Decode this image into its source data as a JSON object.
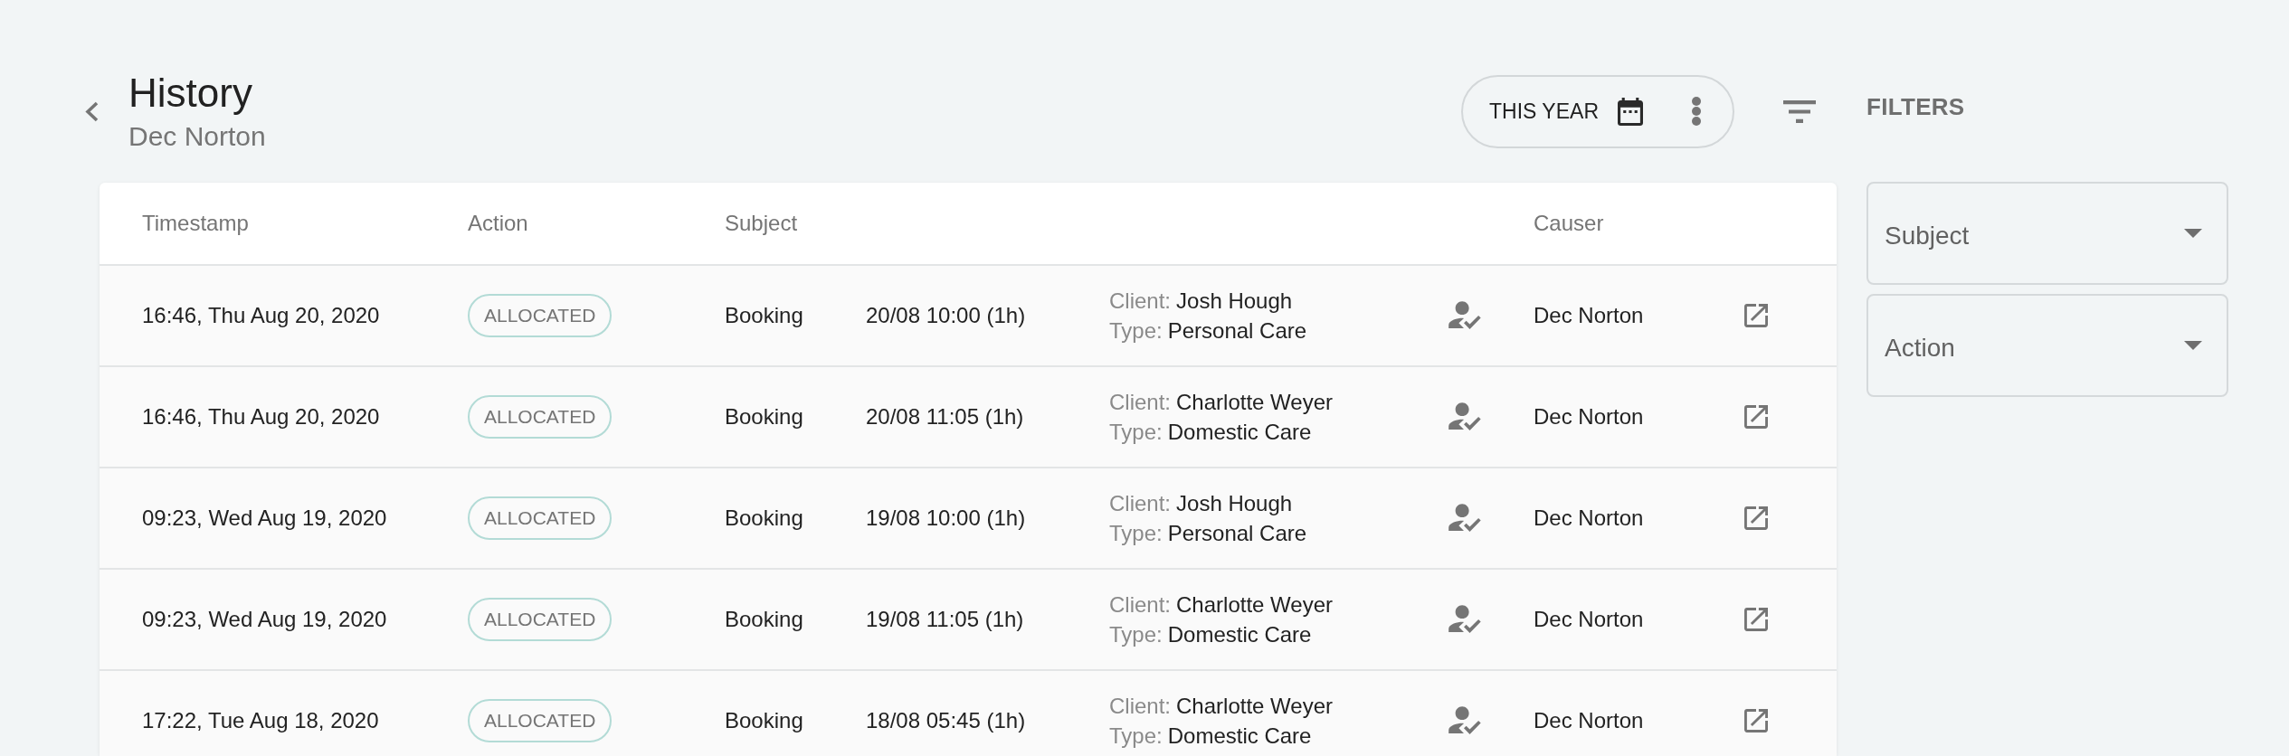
{
  "header": {
    "title": "History",
    "subtitle": "Dec Norton"
  },
  "period_selector": {
    "label": "THIS YEAR"
  },
  "filters": {
    "heading": "FILTERS",
    "dropdowns": [
      {
        "label": "Subject"
      },
      {
        "label": "Action"
      }
    ]
  },
  "table": {
    "columns": [
      {
        "label": "Timestamp"
      },
      {
        "label": "Action"
      },
      {
        "label": "Subject"
      },
      {
        "label": "Causer"
      }
    ],
    "rows": [
      {
        "timestamp": "16:46, Thu Aug 20, 2020",
        "action": "ALLOCATED",
        "subject": "Booking",
        "slot": "20/08 10:00 (1h)",
        "details": [
          {
            "label": "Client:",
            "value": "Josh Hough"
          },
          {
            "label": "Type:",
            "value": "Personal Care"
          }
        ],
        "causer": "Dec Norton"
      },
      {
        "timestamp": "16:46, Thu Aug 20, 2020",
        "action": "ALLOCATED",
        "subject": "Booking",
        "slot": "20/08 11:05 (1h)",
        "details": [
          {
            "label": "Client:",
            "value": "Charlotte Weyer"
          },
          {
            "label": "Type:",
            "value": "Domestic Care"
          }
        ],
        "causer": "Dec Norton"
      },
      {
        "timestamp": "09:23, Wed Aug 19, 2020",
        "action": "ALLOCATED",
        "subject": "Booking",
        "slot": "19/08 10:00 (1h)",
        "details": [
          {
            "label": "Client:",
            "value": "Josh Hough"
          },
          {
            "label": "Type:",
            "value": "Personal Care"
          }
        ],
        "causer": "Dec Norton"
      },
      {
        "timestamp": "09:23, Wed Aug 19, 2020",
        "action": "ALLOCATED",
        "subject": "Booking",
        "slot": "19/08 11:05 (1h)",
        "details": [
          {
            "label": "Client:",
            "value": "Charlotte Weyer"
          },
          {
            "label": "Type:",
            "value": "Domestic Care"
          }
        ],
        "causer": "Dec Norton"
      },
      {
        "timestamp": "17:22, Tue Aug 18, 2020",
        "action": "ALLOCATED",
        "subject": "Booking",
        "slot": "18/08 05:45 (1h)",
        "details": [
          {
            "label": "Client:",
            "value": "Charlotte Weyer"
          },
          {
            "label": "Type:",
            "value": "Domestic Care"
          }
        ],
        "causer": "Dec Norton"
      }
    ]
  }
}
